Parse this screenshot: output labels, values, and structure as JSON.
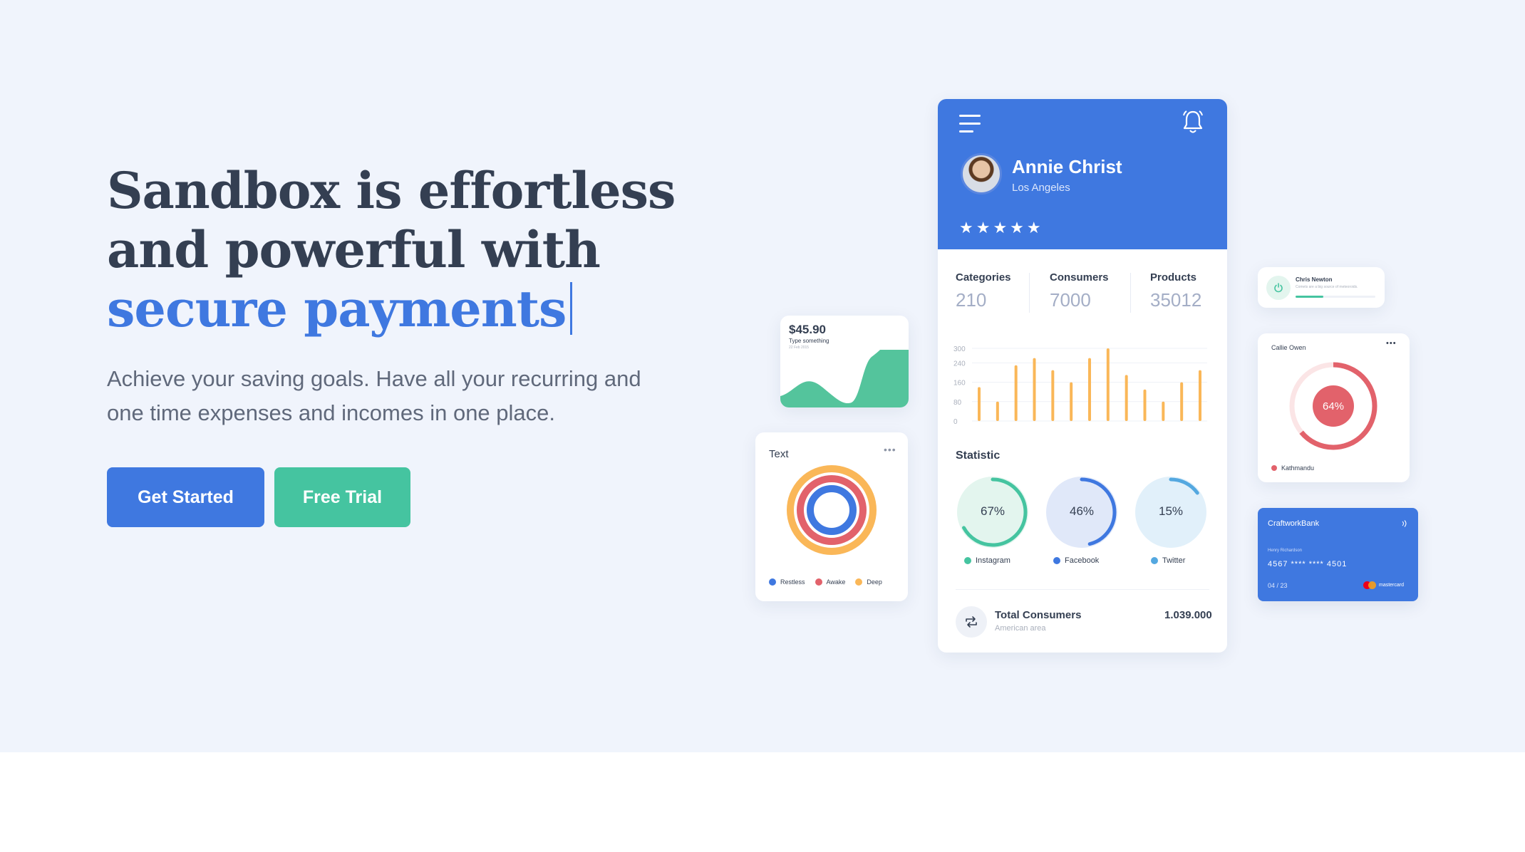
{
  "hero": {
    "headline_line1": "Sandbox is effortless",
    "headline_line2": "and powerful with",
    "headline_accent": "secure payments",
    "lead": "Achieve your saving goals. Have all your recurring and one time expenses and incomes in one place.",
    "primary_button": "Get Started",
    "secondary_button": "Free Trial"
  },
  "colors": {
    "primary": "#3f78e0",
    "success": "#45c4a0",
    "warning": "#fab758",
    "danger": "#e2626b",
    "sky": "#54a8c7",
    "background": "#f0f4fc"
  },
  "phone": {
    "menu_icon": "hamburger-icon",
    "bell_icon": "bell-icon",
    "user_name": "Annie Christ",
    "user_location": "Los Angeles",
    "stars": "★★★★★",
    "rating": 5,
    "stats": [
      {
        "label": "Categories",
        "value": "210"
      },
      {
        "label": "Consumers",
        "value": "7000"
      },
      {
        "label": "Products",
        "value": "35012"
      }
    ],
    "bar_chart": {
      "type": "bar",
      "y_ticks": [
        "300",
        "240",
        "160",
        "80",
        "0"
      ],
      "ylim": [
        0,
        300
      ],
      "values": [
        140,
        80,
        230,
        260,
        210,
        160,
        260,
        300,
        190,
        130,
        80,
        160,
        210
      ],
      "color": "#fab758"
    },
    "statistic_title": "Statistic",
    "rings": [
      {
        "label": "67%",
        "value": 67,
        "legend": "Instagram",
        "color": "#45c4a0",
        "bg": "#e3f5ee"
      },
      {
        "label": "46%",
        "value": 46,
        "legend": "Facebook",
        "color": "#3f78e0",
        "bg": "#e0e8f9"
      },
      {
        "label": "15%",
        "value": 15,
        "legend": "Twitter",
        "color": "#54a8e0",
        "bg": "#e1f0fa"
      }
    ],
    "total_title": "Total Consumers",
    "total_sub": "American area",
    "total_value": "1.039.000"
  },
  "area_card": {
    "price": "$45.90",
    "subtitle": "Type something",
    "date": "22 Feb 2015"
  },
  "concentric_card": {
    "title": "Text",
    "legend": [
      {
        "label": "Restless",
        "color": "#3f78e0"
      },
      {
        "label": "Awake",
        "color": "#e2626b"
      },
      {
        "label": "Deep",
        "color": "#fab758"
      }
    ]
  },
  "chris_card": {
    "name": "Chris Newton",
    "subtitle": "Comets are a big source of meteoroids.",
    "progress": 0.35
  },
  "callie_card": {
    "name": "Callie Owen",
    "percent_label": "64%",
    "value": 64,
    "legend": "Kathmandu"
  },
  "bank_card": {
    "bank": "CraftworkBank",
    "holder": "Henry Richardson",
    "number": "4567 **** **** 4501",
    "expiry": "04 / 23",
    "brand": "mastercard"
  }
}
